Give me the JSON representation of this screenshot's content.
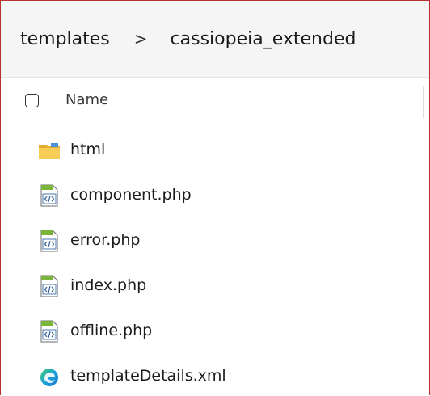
{
  "breadcrumb": {
    "items": [
      "templates",
      "cassiopeia_extended"
    ],
    "separator": ">"
  },
  "header": {
    "name_label": "Name"
  },
  "files": [
    {
      "name": "html",
      "icon": "folder-icon"
    },
    {
      "name": "component.php",
      "icon": "php-file-icon"
    },
    {
      "name": "error.php",
      "icon": "php-file-icon"
    },
    {
      "name": "index.php",
      "icon": "php-file-icon"
    },
    {
      "name": "offline.php",
      "icon": "php-file-icon"
    },
    {
      "name": "templateDetails.xml",
      "icon": "edge-xml-file-icon"
    }
  ],
  "colors": {
    "frame_border": "#b83232",
    "folder": "#f3c74b",
    "edge_blue": "#1473d2",
    "edge_green": "#3fcf6a"
  }
}
